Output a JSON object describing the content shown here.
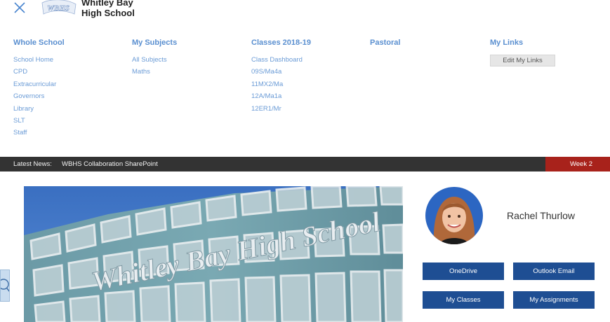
{
  "header": {
    "logo_text": "WBHS",
    "school_name_line1": "Whitley Bay",
    "school_name_line2": "High School"
  },
  "menu": {
    "columns": [
      {
        "heading": "Whole School",
        "items": [
          "School Home",
          "CPD",
          "Extracurricular",
          "Governors",
          "Library",
          "SLT",
          "Staff"
        ]
      },
      {
        "heading": "My Subjects",
        "items": [
          "All Subjects",
          "Maths"
        ]
      },
      {
        "heading": "Classes 2018-19",
        "items": [
          "Class Dashboard",
          "09S/Ma4a",
          "11MX2/Ma",
          "12A/Ma1a",
          "12ER1/Mr"
        ]
      },
      {
        "heading": "Pastoral",
        "items": []
      },
      {
        "heading": "My Links",
        "items": []
      }
    ],
    "edit_links_label": "Edit My Links"
  },
  "news": {
    "label": "Latest News:",
    "item": "WBHS Collaboration SharePoint",
    "week": "Week 2"
  },
  "hero": {
    "sign_text": "Whitley Bay High School"
  },
  "profile": {
    "name": "Rachel Thurlow"
  },
  "quick_links": {
    "onedrive": "OneDrive",
    "outlook": "Outlook Email",
    "classes": "My Classes",
    "assignments": "My Assignments"
  },
  "colors": {
    "link": "#6a9bd6",
    "heading": "#5a8fd0",
    "newsbar": "#333333",
    "week_badge": "#a8221b",
    "button": "#1e4e93"
  }
}
